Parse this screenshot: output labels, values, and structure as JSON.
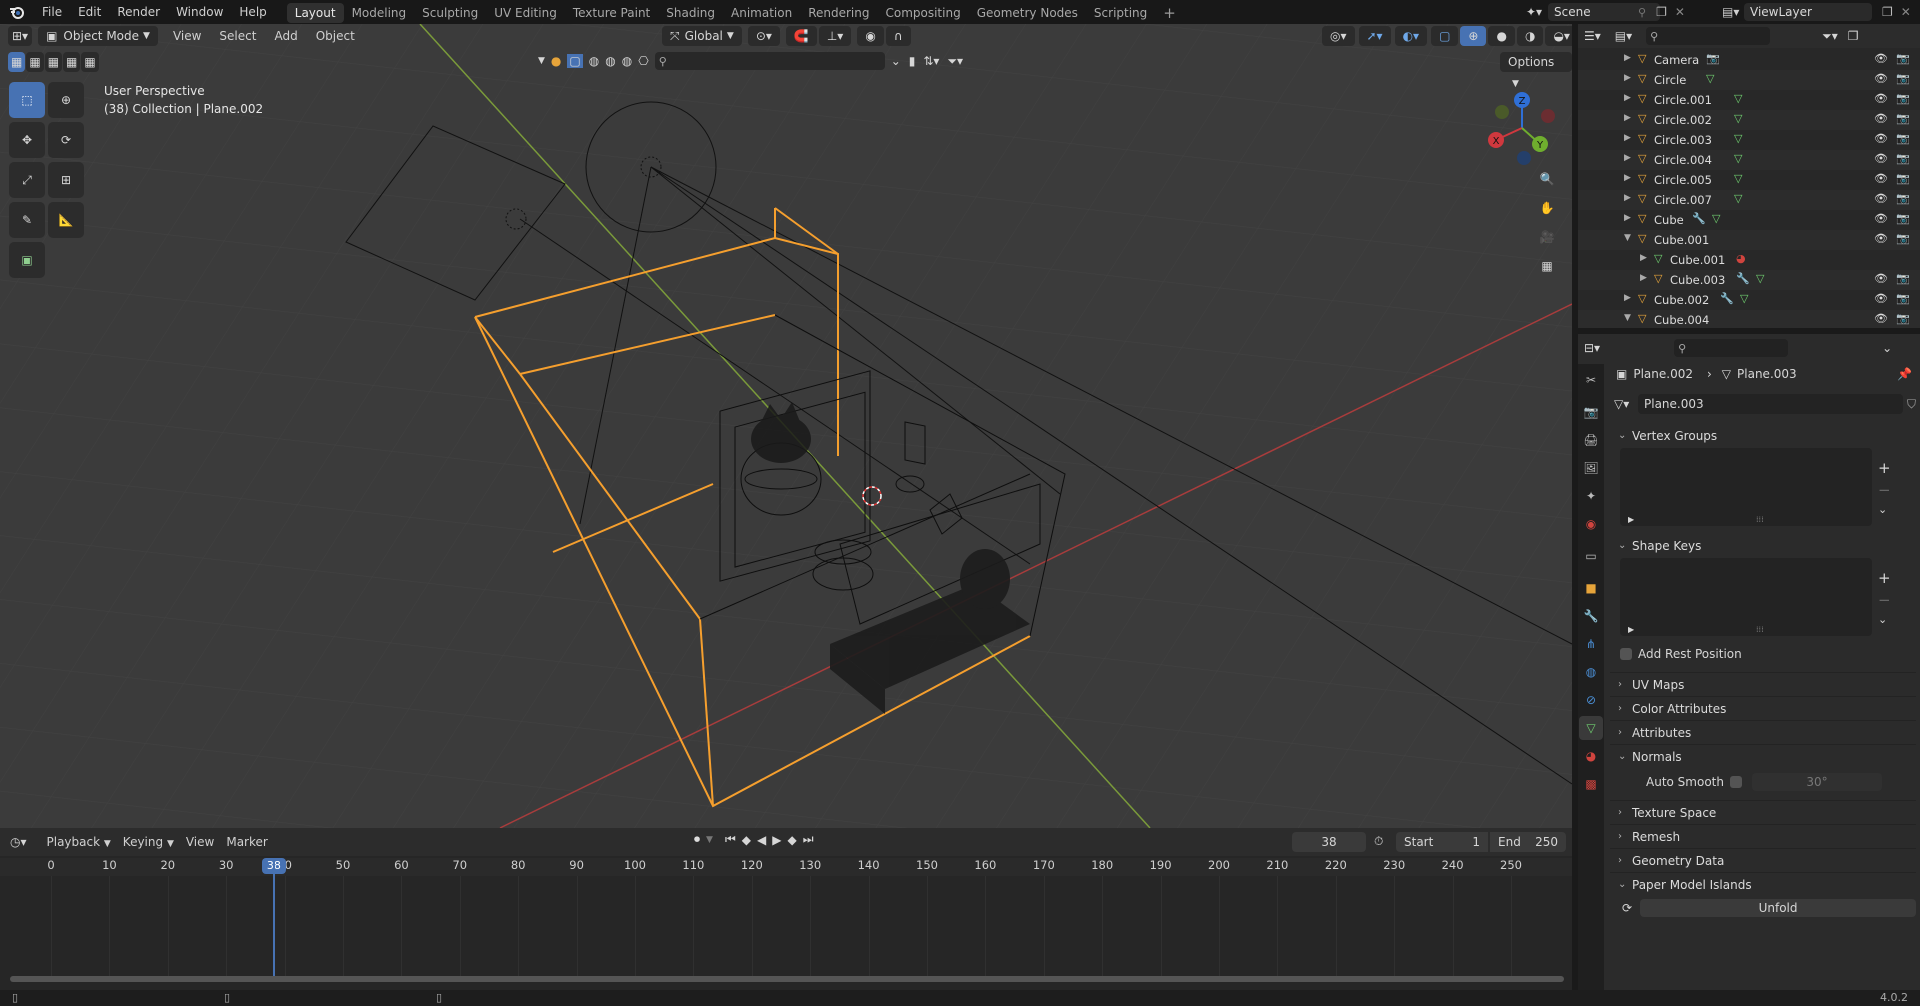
{
  "top_menu": [
    "File",
    "Edit",
    "Render",
    "Window",
    "Help"
  ],
  "workspaces": [
    {
      "label": "Layout",
      "active": true
    },
    {
      "label": "Modeling"
    },
    {
      "label": "Sculpting"
    },
    {
      "label": "UV Editing"
    },
    {
      "label": "Texture Paint"
    },
    {
      "label": "Shading"
    },
    {
      "label": "Animation"
    },
    {
      "label": "Rendering"
    },
    {
      "label": "Compositing"
    },
    {
      "label": "Geometry Nodes"
    },
    {
      "label": "Scripting"
    }
  ],
  "scene": {
    "name": "Scene",
    "view_layer": "ViewLayer"
  },
  "viewport": {
    "mode": "Object Mode",
    "menus": [
      "View",
      "Select",
      "Add",
      "Object"
    ],
    "transform_orientation": "Global",
    "overlay_title": "User Perspective",
    "overlay_subtitle": "(38) Collection | Plane.002",
    "options_label": "Options",
    "gizmo_axes": {
      "x": "X",
      "y": "Y",
      "z": "Z"
    },
    "accent": "#4772b3",
    "selection_color": "#f59f2e"
  },
  "outliner": {
    "items": [
      {
        "name": "Camera",
        "indent": 0,
        "expanded": false,
        "type": "camera",
        "extra": [
          "camera-data"
        ]
      },
      {
        "name": "Circle",
        "indent": 0,
        "expanded": false,
        "type": "mesh",
        "extra": [
          "mesh-data"
        ]
      },
      {
        "name": "Circle.001",
        "indent": 0,
        "expanded": false,
        "type": "mesh",
        "extra": [
          "mesh-data"
        ]
      },
      {
        "name": "Circle.002",
        "indent": 0,
        "expanded": false,
        "type": "mesh",
        "extra": [
          "mesh-data"
        ]
      },
      {
        "name": "Circle.003",
        "indent": 0,
        "expanded": false,
        "type": "mesh",
        "extra": [
          "mesh-data"
        ]
      },
      {
        "name": "Circle.004",
        "indent": 0,
        "expanded": false,
        "type": "mesh",
        "extra": [
          "mesh-data"
        ]
      },
      {
        "name": "Circle.005",
        "indent": 0,
        "expanded": false,
        "type": "mesh",
        "extra": [
          "mesh-data"
        ]
      },
      {
        "name": "Circle.007",
        "indent": 0,
        "expanded": false,
        "type": "mesh",
        "extra": [
          "mesh-data"
        ]
      },
      {
        "name": "Cube",
        "indent": 0,
        "expanded": false,
        "type": "mesh",
        "extra": [
          "modifier",
          "mesh-data"
        ]
      },
      {
        "name": "Cube.001",
        "indent": 0,
        "expanded": true,
        "type": "mesh",
        "extra": []
      },
      {
        "name": "Cube.001",
        "indent": 1,
        "expanded": false,
        "type": "meshdata",
        "extra": [
          "material"
        ]
      },
      {
        "name": "Cube.003",
        "indent": 1,
        "expanded": false,
        "type": "mesh",
        "extra": [
          "modifier",
          "mesh-data"
        ]
      },
      {
        "name": "Cube.002",
        "indent": 0,
        "expanded": false,
        "type": "mesh",
        "extra": [
          "modifier",
          "mesh-data"
        ]
      },
      {
        "name": "Cube.004",
        "indent": 0,
        "expanded": true,
        "type": "mesh",
        "extra": []
      }
    ]
  },
  "properties": {
    "breadcrumb": {
      "object": "Plane.002",
      "data": "Plane.003"
    },
    "datablock_name": "Plane.003",
    "panels": {
      "vertex_groups": "Vertex Groups",
      "shape_keys": "Shape Keys",
      "add_rest_position": "Add Rest Position",
      "uv_maps": "UV Maps",
      "color_attributes": "Color Attributes",
      "attributes": "Attributes",
      "normals": "Normals",
      "auto_smooth": "Auto Smooth",
      "auto_smooth_angle": "30°",
      "texture_space": "Texture Space",
      "remesh": "Remesh",
      "geometry_data": "Geometry Data",
      "paper_model_islands": "Paper Model Islands",
      "unfold": "Unfold"
    }
  },
  "timeline": {
    "menus": [
      "Playback",
      "Keying",
      "View",
      "Marker"
    ],
    "current_frame": "38",
    "start_label": "Start",
    "start": "1",
    "end_label": "End",
    "end": "250",
    "ruler": [
      "0",
      "10",
      "20",
      "30",
      "40",
      "50",
      "60",
      "70",
      "80",
      "90",
      "100",
      "110",
      "120",
      "130",
      "140",
      "150",
      "160",
      "170",
      "180",
      "190",
      "200",
      "210",
      "220",
      "230",
      "240",
      "250"
    ],
    "playhead_label": "38"
  },
  "status": {
    "version": "4.0.2"
  }
}
